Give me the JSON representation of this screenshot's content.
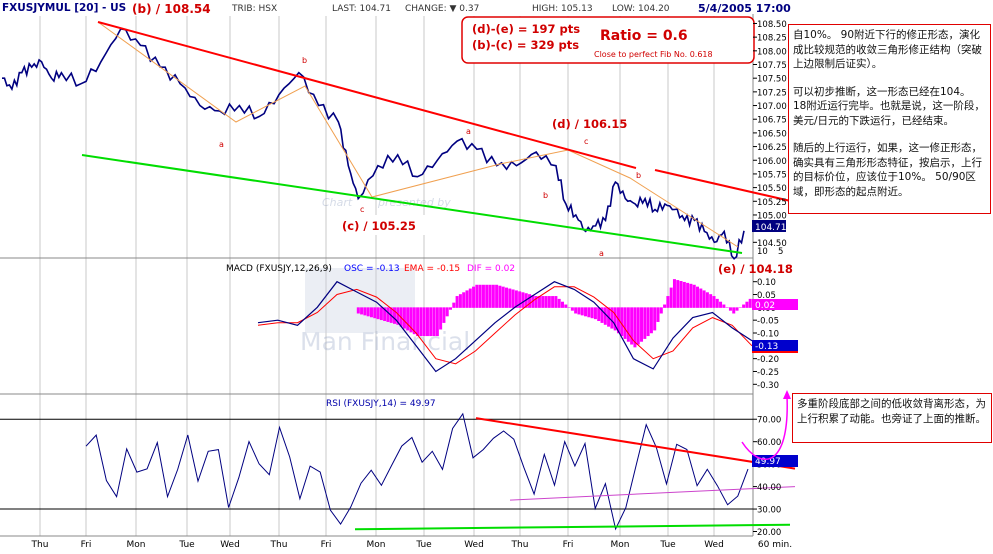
{
  "header": {
    "symbol": "FXUSJYMUL [20] - US",
    "high_label": "(b) / 108.54",
    "exchange": "TRIB: HSX",
    "last": "LAST: 104.71",
    "change": "CHANGE: ▼ 0.37",
    "high": "HIGH: 105.13",
    "low": "LOW: 104.20",
    "datetime": "5/4/2005 17:00"
  },
  "ratio_box": {
    "line1": "(d)-(e) =  197 pts",
    "line2": "(b)-(c) =  329 pts",
    "ratio": "Ratio = 0.6",
    "fib_note": "Close to perfect Fib No. 0.618"
  },
  "price_labels": {
    "d": "(d) / 106.15",
    "c": "(c) / 105.25",
    "e": "(e) / 104.18",
    "last_tag": "104.71",
    "scale_last": "104.5",
    "sub_a1": "a",
    "sub_b1": "b",
    "sub_c1": "c",
    "sub_a2": "a",
    "sub_b2": "b",
    "sub_c2": "c",
    "sub_b3": "b",
    "sub_a3": "a",
    "partial_tick": "10",
    "partial_tick2": "5"
  },
  "watermark": {
    "chart": "Chart",
    "presented": "presented by",
    "brand": "Man Financial"
  },
  "macd_header": {
    "prefix": "MACD (FXUSJY,12,26,9)",
    "osc": "OSC = -0.13",
    "ema": "EMA = -0.15",
    "dif": "DIF = 0.02"
  },
  "macd_tags": {
    "dif": "0.02",
    "osc": "-0.13"
  },
  "rsi_header": "RSI (FXUSJY,14) = 49.97",
  "rsi_tag": "49.97",
  "notes": {
    "note1": [
      "自10%。 90附近下行的修正形态，演化成比较规范的收敛三角形修正结构（突破上边限制后证实）。",
      "可以初步推断，这一形态已经在104。 18附近运行完毕。也就是说，这一阶段，美元/日元的下跌运行，已经结束。",
      "随后的上行运行，如果，这一修正形态，确实具有三角形形态特征，按启示，上行的目标价位，应该位于10%。 50/90区域，即形态的起点附近。"
    ],
    "note2": [
      "多重阶段底部之间的低收敛背离形态，为上行积累了动能。也旁证了上面的推断。"
    ]
  },
  "colors": {
    "price": "#000080",
    "trend_red": "#ff0000",
    "trend_green": "#00dd00",
    "wave_orange": "#f0a050",
    "macd_hist": "#ff00ff",
    "macd_signal": "#ff0000",
    "macd_line": "#000080",
    "rsi_line": "#000080",
    "rsi_support": "#cc44cc"
  },
  "chart_data": [
    {
      "type": "line",
      "name": "price",
      "y_ticks": [
        "108.50",
        "108.25",
        "108.00",
        "107.75",
        "107.50",
        "107.25",
        "107.00",
        "106.75",
        "106.50",
        "106.25",
        "106.00",
        "105.75",
        "105.50",
        "105.25",
        "105.00",
        "104.50"
      ],
      "ylim": [
        104.25,
        108.6
      ],
      "x_ticks": [
        "Thu",
        "Fri",
        "Mon",
        "Tue",
        "Wed",
        "Thu",
        "Fri",
        "Mon",
        "Tue",
        "Wed",
        "Thu",
        "Fri",
        "Mon",
        "Tue",
        "Wed",
        "60 min."
      ],
      "x": [
        0,
        10,
        20,
        30,
        40,
        50,
        60,
        80,
        100,
        120,
        140,
        160,
        180,
        200,
        220,
        240,
        260,
        280,
        300,
        320,
        340,
        350,
        360,
        380,
        400,
        420,
        440,
        460,
        480,
        500,
        520,
        540,
        560,
        570,
        580,
        590,
        600,
        610,
        620,
        630,
        640,
        650,
        660,
        670,
        680,
        690,
        700,
        710,
        720,
        730,
        740,
        750
      ],
      "values": [
        107.5,
        107.3,
        107.6,
        107.7,
        107.8,
        107.5,
        107.6,
        107.4,
        107.8,
        108.4,
        108.1,
        107.7,
        107.4,
        107.0,
        106.9,
        107.0,
        106.8,
        107.2,
        107.6,
        107.0,
        106.7,
        105.9,
        105.3,
        105.9,
        106.1,
        105.7,
        106.0,
        106.35,
        106.2,
        105.9,
        105.9,
        106.15,
        105.9,
        105.2,
        105.0,
        104.7,
        104.8,
        104.9,
        105.6,
        105.3,
        105.2,
        105.3,
        105.1,
        105.2,
        105.1,
        104.9,
        104.9,
        104.7,
        104.5,
        104.7,
        104.2,
        104.71
      ],
      "annotations": [
        "(b) / 108.54",
        "(c) / 105.25",
        "(d) / 106.15",
        "(e) / 104.18"
      ]
    },
    {
      "type": "line",
      "name": "MACD",
      "y_ticks": [
        "0.10",
        "0.05",
        "0.00",
        "-0.05",
        "-0.10",
        "-0.15",
        "-0.20",
        "-0.25",
        "-0.30"
      ],
      "ylim": [
        -0.33,
        0.13
      ],
      "x": [
        0,
        20,
        40,
        60,
        80,
        100,
        120,
        140,
        160,
        180,
        200,
        220,
        240,
        260,
        280,
        300,
        320,
        340,
        360,
        380,
        400,
        420,
        440,
        460,
        480,
        500
      ],
      "dif": [
        -0.06,
        -0.05,
        -0.07,
        0.0,
        0.1,
        0.06,
        0.02,
        -0.05,
        -0.15,
        -0.25,
        -0.2,
        -0.13,
        -0.06,
        0.0,
        0.05,
        0.1,
        0.07,
        0.02,
        -0.06,
        -0.2,
        -0.24,
        -0.12,
        -0.04,
        -0.02,
        -0.08,
        -0.13
      ],
      "ema": [
        -0.07,
        -0.06,
        -0.06,
        -0.02,
        0.05,
        0.07,
        0.04,
        -0.02,
        -0.1,
        -0.2,
        -0.22,
        -0.17,
        -0.1,
        -0.03,
        0.03,
        0.08,
        0.08,
        0.04,
        -0.02,
        -0.13,
        -0.2,
        -0.17,
        -0.08,
        -0.04,
        -0.07,
        -0.15
      ]
    },
    {
      "type": "line",
      "name": "RSI",
      "y_ticks": [
        "70.00",
        "60.00",
        "50.00",
        "40.00",
        "30.00",
        "20.00"
      ],
      "ylim": [
        18,
        75
      ],
      "x": [
        0,
        10,
        20,
        30,
        40,
        50,
        60,
        70,
        80,
        90,
        100,
        110,
        120,
        130,
        140,
        150,
        160,
        170,
        180,
        190,
        200,
        210,
        220,
        230,
        240,
        250,
        260,
        270,
        280,
        290,
        300,
        310,
        320,
        330,
        340,
        350,
        360,
        370,
        380,
        390,
        400,
        410,
        420,
        430,
        440,
        450,
        460,
        470,
        480,
        490,
        500,
        510,
        520,
        530,
        540,
        550,
        560,
        570,
        580,
        590,
        600,
        610,
        620,
        630,
        640,
        650
      ],
      "values": [
        58,
        65,
        45,
        36,
        55,
        44,
        47,
        61,
        38,
        49,
        62,
        40,
        54,
        57,
        33,
        46,
        60,
        48,
        43,
        66,
        55,
        37,
        50,
        45,
        27,
        22,
        32,
        44,
        49,
        40,
        47,
        56,
        62,
        53,
        58,
        48,
        64,
        70,
        52,
        58,
        64,
        66,
        60,
        46,
        35,
        55,
        43,
        62,
        49,
        57,
        28,
        41,
        23,
        33,
        50,
        66,
        55,
        40,
        60,
        59,
        42,
        47,
        38,
        30,
        36,
        50
      ],
      "current": 49.97
    }
  ]
}
